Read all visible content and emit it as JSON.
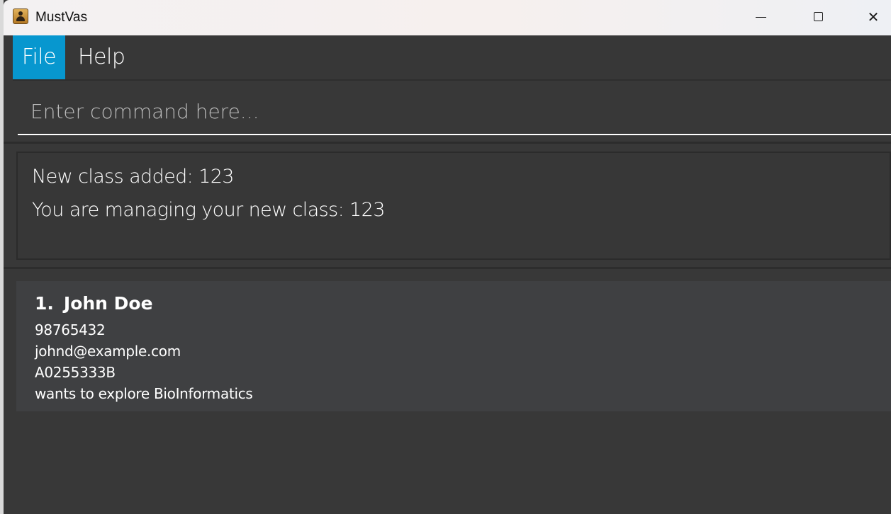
{
  "window": {
    "title": "MustVas",
    "close_glyph": "✕"
  },
  "menu": {
    "items": [
      {
        "label": "File",
        "active": true
      },
      {
        "label": "Help",
        "active": false
      }
    ]
  },
  "command_box": {
    "placeholder": "Enter command here...",
    "value": ""
  },
  "result_display": {
    "lines": [
      "New class added: 123",
      "You are managing your new class: 123"
    ]
  },
  "person_list": {
    "persons": [
      {
        "index": "1.",
        "name": "John Doe",
        "phone": "98765432",
        "email": "johnd@example.com",
        "student_id": "A0255333B",
        "remark": "wants to explore BioInformatics"
      }
    ]
  },
  "icons": {
    "app": "address-book-icon",
    "minimize": "minimize-icon",
    "maximize": "maximize-icon",
    "close": "close-icon"
  },
  "colors": {
    "accent": "#0797cf",
    "background": "#383838",
    "card": "#3f4042",
    "text": "#ffffff"
  }
}
